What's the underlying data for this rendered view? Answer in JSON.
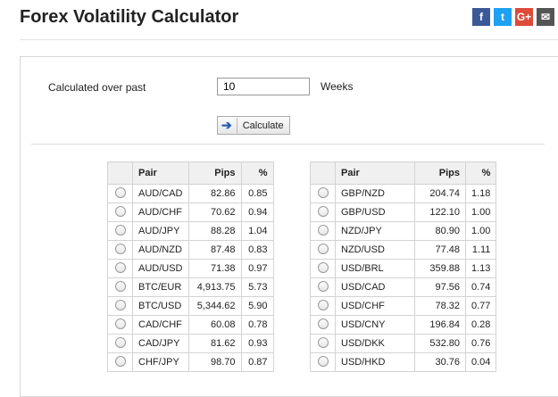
{
  "header": {
    "title": "Forex Volatility Calculator",
    "social": [
      {
        "icon": "facebook-icon",
        "glyph": "f"
      },
      {
        "icon": "twitter-icon",
        "glyph": "t"
      },
      {
        "icon": "google-plus-icon",
        "glyph": "G+"
      },
      {
        "icon": "email-icon",
        "glyph": "✉"
      }
    ]
  },
  "form": {
    "label": "Calculated over past",
    "weeks_value": "10",
    "unit_label": "Weeks",
    "button_label": "Calculate",
    "button_icon": "arrow-right-icon"
  },
  "table_headers": {
    "pair": "Pair",
    "pips": "Pips",
    "pct": "%"
  },
  "left_rows": [
    {
      "pair": "AUD/CAD",
      "pips": "82.86",
      "pct": "0.85"
    },
    {
      "pair": "AUD/CHF",
      "pips": "70.62",
      "pct": "0.94"
    },
    {
      "pair": "AUD/JPY",
      "pips": "88.28",
      "pct": "1.04"
    },
    {
      "pair": "AUD/NZD",
      "pips": "87.48",
      "pct": "0.83"
    },
    {
      "pair": "AUD/USD",
      "pips": "71.38",
      "pct": "0.97"
    },
    {
      "pair": "BTC/EUR",
      "pips": "4,913.75",
      "pct": "5.73"
    },
    {
      "pair": "BTC/USD",
      "pips": "5,344.62",
      "pct": "5.90"
    },
    {
      "pair": "CAD/CHF",
      "pips": "60.08",
      "pct": "0.78"
    },
    {
      "pair": "CAD/JPY",
      "pips": "81.62",
      "pct": "0.93"
    },
    {
      "pair": "CHF/JPY",
      "pips": "98.70",
      "pct": "0.87"
    }
  ],
  "right_rows": [
    {
      "pair": "GBP/NZD",
      "pips": "204.74",
      "pct": "1.18"
    },
    {
      "pair": "GBP/USD",
      "pips": "122.10",
      "pct": "1.00"
    },
    {
      "pair": "NZD/JPY",
      "pips": "80.90",
      "pct": "1.00"
    },
    {
      "pair": "NZD/USD",
      "pips": "77.48",
      "pct": "1.11"
    },
    {
      "pair": "USD/BRL",
      "pips": "359.88",
      "pct": "1.13"
    },
    {
      "pair": "USD/CAD",
      "pips": "97.56",
      "pct": "0.74"
    },
    {
      "pair": "USD/CHF",
      "pips": "78.32",
      "pct": "0.77"
    },
    {
      "pair": "USD/CNY",
      "pips": "196.84",
      "pct": "0.28"
    },
    {
      "pair": "USD/DKK",
      "pips": "532.80",
      "pct": "0.76"
    },
    {
      "pair": "USD/HKD",
      "pips": "30.76",
      "pct": "0.04"
    }
  ]
}
